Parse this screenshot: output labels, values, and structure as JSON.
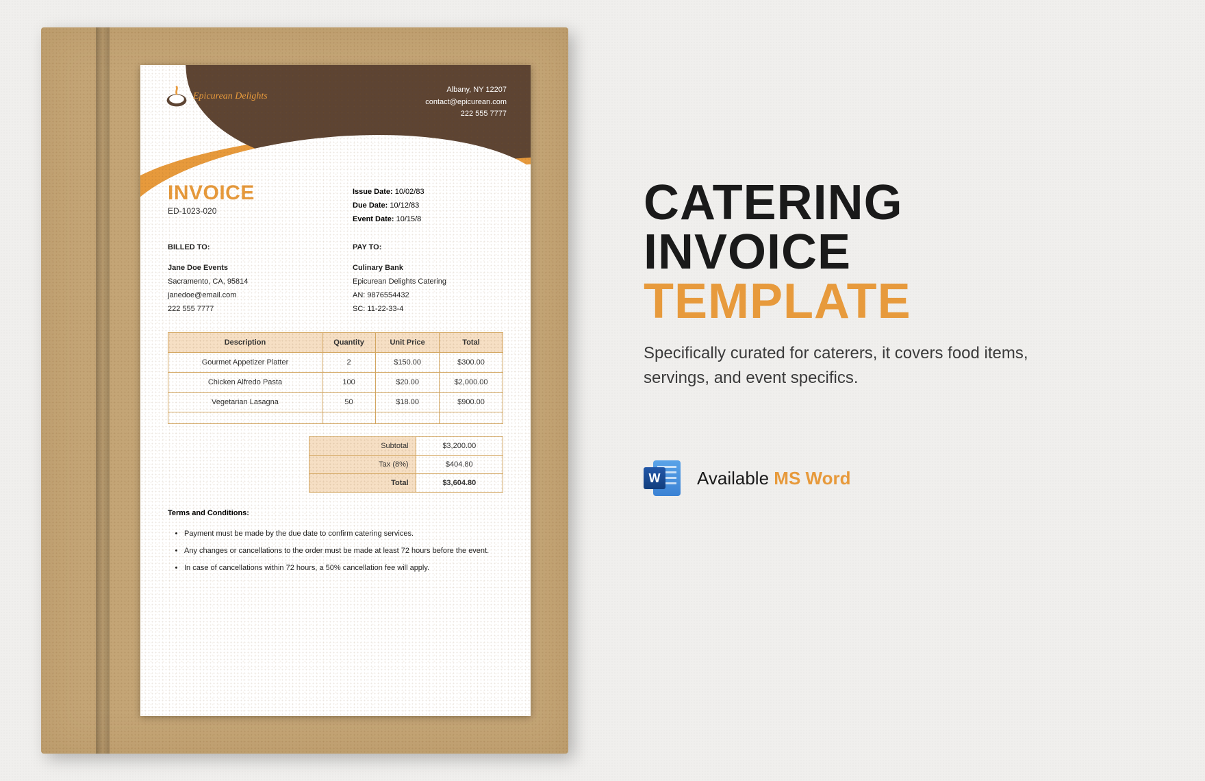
{
  "company": {
    "name": "Epicurean Delights",
    "address": "Albany, NY 12207",
    "email": "contact@epicurean.com",
    "phone": "222 555 7777"
  },
  "invoice": {
    "title": "INVOICE",
    "number": "ED-1023-020",
    "issue_date_label": "Issue Date:",
    "issue_date": "10/02/83",
    "due_date_label": "Due Date:",
    "due_date": "10/12/83",
    "event_date_label": "Event Date:",
    "event_date": "10/15/8"
  },
  "billed_to": {
    "label": "BILLED TO:",
    "name": "Jane Doe Events",
    "city": "Sacramento, CA, 95814",
    "email": "janedoe@email.com",
    "phone": "222 555 7777"
  },
  "pay_to": {
    "label": "PAY TO:",
    "bank": "Culinary Bank",
    "company": "Epicurean Delights Catering",
    "an_label": "AN:",
    "an": "9876554432",
    "sc_label": "SC:",
    "sc": "11-22-33-4"
  },
  "table": {
    "headers": {
      "desc": "Description",
      "qty": "Quantity",
      "unit": "Unit Price",
      "total": "Total"
    },
    "rows": [
      {
        "desc": "Gourmet Appetizer Platter",
        "qty": "2",
        "unit": "$150.00",
        "total": "$300.00"
      },
      {
        "desc": "Chicken Alfredo Pasta",
        "qty": "100",
        "unit": "$20.00",
        "total": "$2,000.00"
      },
      {
        "desc": "Vegetarian Lasagna",
        "qty": "50",
        "unit": "$18.00",
        "total": "$900.00"
      },
      {
        "desc": "",
        "qty": "",
        "unit": "",
        "total": ""
      }
    ]
  },
  "totals": {
    "subtotal_label": "Subtotal",
    "subtotal": "$3,200.00",
    "tax_label": "Tax (8%)",
    "tax": "$404.80",
    "total_label": "Total",
    "total": "$3,604.80"
  },
  "terms": {
    "heading": "Terms and Conditions:",
    "items": [
      "Payment must be made by the due date to confirm catering services.",
      "Any changes or cancellations to the order must be made at least 72 hours before the event.",
      "In case of cancellations within 72 hours, a 50% cancellation fee will apply."
    ]
  },
  "promo": {
    "line1": "CATERING",
    "line2": "INVOICE",
    "line3": "TEMPLATE",
    "sub": "Specifically curated for caterers, it covers food items, servings, and event specifics.",
    "avail_prefix": "Available",
    "avail_app": "MS Word",
    "word_letter": "W"
  },
  "colors": {
    "accent": "#e79a3c",
    "brown": "#5d4433"
  }
}
